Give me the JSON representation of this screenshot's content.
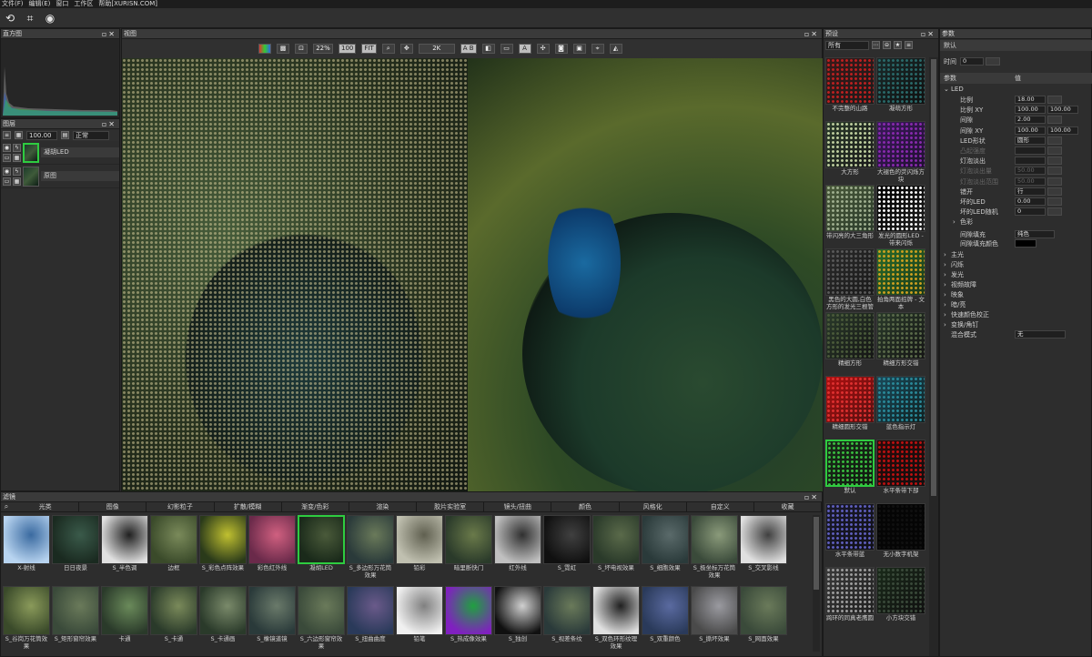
{
  "menu": [
    "文件(F)",
    "编辑(E)",
    "窗口",
    "工作区",
    "帮助[XURISN.COM]"
  ],
  "toolbar_icons": [
    "refresh-icon",
    "crop-icon",
    "compare-icon"
  ],
  "histogram": {
    "title": "直方图"
  },
  "layers": {
    "title": "图层",
    "opacity": "100.00",
    "blend_mode": "正常",
    "items": [
      {
        "name": "凝胡LED"
      },
      {
        "name": "原图"
      }
    ]
  },
  "view": {
    "title": "视图",
    "zoom": "22%",
    "btn_100": "100",
    "btn_fit": "FIT",
    "res_select": "2K",
    "ab_label": "A B",
    "ab2_label": "A"
  },
  "presets": {
    "title": "预设",
    "filter": "所有",
    "items": [
      {
        "label": "不完整的山路",
        "colors": [
          "#3a1a1a",
          "#c02020",
          "#1a1a1a"
        ]
      },
      {
        "label": "凝萌方形",
        "colors": [
          "#1a2a2a",
          "#2a6a6a",
          "#101010"
        ]
      },
      {
        "label": "大方形",
        "colors": [
          "#2a3a2a",
          "#c0d0a0",
          "#1a1a1a"
        ]
      },
      {
        "label": "大褪色的荧闪烁方块",
        "colors": [
          "#3a1a5a",
          "#8a2ab0",
          "#201030"
        ]
      },
      {
        "label": "带闪亮的大三角形",
        "colors": [
          "#4a5a3a",
          "#a0b090",
          "#2a3a2a"
        ]
      },
      {
        "label": "发光的圆形LED - 带来闪烁",
        "colors": [
          "#000000",
          "#ffffff",
          "#202020"
        ]
      },
      {
        "label": "黑色的大圆,白色方形的发光三根管",
        "colors": [
          "#2a2a2a",
          "#5a5a5a",
          "#1a1a1a"
        ]
      },
      {
        "label": "拍角两面招牌 - 文本",
        "colors": [
          "#2a6a2a",
          "#d0a020",
          "#1a3a1a"
        ]
      },
      {
        "label": "精细方形",
        "colors": [
          "#2a3a2a",
          "#4a5a3a",
          "#151515"
        ]
      },
      {
        "label": "精细方形交错",
        "colors": [
          "#2a3a2a",
          "#5a6a4a",
          "#151515"
        ]
      },
      {
        "label": "精细圆形交错",
        "colors": [
          "#b01010",
          "#e03030",
          "#501010"
        ]
      },
      {
        "label": "蓝色指示灯",
        "colors": [
          "#1a4a5a",
          "#2a8a9a",
          "#102020"
        ]
      },
      {
        "label": "默认",
        "colors": [
          "#1a2a1a",
          "#3ac040",
          "#101a10"
        ]
      },
      {
        "label": "水平条带下部",
        "colors": [
          "#2a0a0a",
          "#c01010",
          "#101010"
        ]
      },
      {
        "label": "水平条带蓝",
        "colors": [
          "#1a1a2a",
          "#6060c0",
          "#101018"
        ]
      },
      {
        "label": "无小数字机架",
        "colors": [
          "#050505",
          "#101010",
          "#050505"
        ]
      },
      {
        "label": "跨环的同真老鹰圆",
        "colors": [
          "#3a3a3a",
          "#a0a0a0",
          "#202020"
        ]
      },
      {
        "label": "小方块交错",
        "colors": [
          "#1a2a1a",
          "#3a4a3a",
          "#101010"
        ]
      }
    ]
  },
  "params": {
    "title": "参数",
    "preset_label": "默认",
    "time_label": "时间",
    "time_value": "0",
    "col_param": "参数",
    "col_value": "值",
    "group_led": "LED",
    "rows": [
      {
        "label": "比例",
        "v1": "18.00",
        "v2": "",
        "dim": false
      },
      {
        "label": "比例 XY",
        "v1": "100.00",
        "v2": "100.00",
        "dim": false
      },
      {
        "label": "间隙",
        "v1": "2.00",
        "v2": "",
        "dim": false
      },
      {
        "label": "间隙 XY",
        "v1": "100.00",
        "v2": "100.00",
        "dim": false
      },
      {
        "label": "LED形状",
        "v1": "圆形",
        "v2": "",
        "dim": false
      },
      {
        "label": "凸起强度",
        "v1": "",
        "v2": "",
        "dim": true
      },
      {
        "label": "灯泡淡出",
        "v1": "",
        "v2": "",
        "dim": false
      },
      {
        "label": "灯泡淡出量",
        "v1": "50.00",
        "v2": "",
        "dim": true
      },
      {
        "label": "灯泡淡出范围",
        "v1": "50.00",
        "v2": "",
        "dim": true
      },
      {
        "label": "错开",
        "v1": "行",
        "v2": "",
        "dim": false
      },
      {
        "label": "坏的LED",
        "v1": "0.00",
        "v2": "",
        "dim": false
      },
      {
        "label": "坏的LED随机",
        "v1": "0",
        "v2": "",
        "dim": false
      }
    ],
    "sub_color": "色彩",
    "gap_fill_label": "间隙填充",
    "gap_fill_value": "纯色",
    "gap_color_label": "间隙填充颜色",
    "groups": [
      "主光",
      "闪烁",
      "发光",
      "视频故障",
      "映象",
      "暗/亮",
      "快速颜色校正",
      "变换/角钉"
    ],
    "blend_label": "混合模式",
    "blend_value": "无"
  },
  "filters": {
    "title": "滤镜",
    "categories": [
      "光类",
      "图像",
      "幻影粒子",
      "扩散/模糊",
      "渐变/色彩",
      "渲染",
      "胶片实验室",
      "镜头/扭曲",
      "颜色",
      "风格化",
      "自定义",
      "收藏"
    ],
    "items": [
      {
        "label": "X-射线",
        "colors": [
          "#b8d4f0",
          "#3a6aa0"
        ]
      },
      {
        "label": "日日夜景",
        "colors": [
          "#1a2a20",
          "#3a5a4a"
        ]
      },
      {
        "label": "S_半色调",
        "colors": [
          "#e0e0e0",
          "#202020"
        ]
      },
      {
        "label": "边框",
        "colors": [
          "#3a4a2a",
          "#7a8a5a"
        ]
      },
      {
        "label": "S_彩色点阵效果",
        "colors": [
          "#2a3a1a",
          "#c0c030"
        ]
      },
      {
        "label": "彩色红外线",
        "colors": [
          "#6a2a4a",
          "#d06080"
        ]
      },
      {
        "label": "凝胡LED",
        "colors": [
          "#1a2a1a",
          "#4a5a3a"
        ],
        "sel": true
      },
      {
        "label": "S_多边形万花筒效果",
        "colors": [
          "#2a3a3a",
          "#6a7a5a"
        ]
      },
      {
        "label": "铅彩",
        "colors": [
          "#c0c0b0",
          "#606050"
        ]
      },
      {
        "label": "暗里断快门",
        "colors": [
          "#2a3a2a",
          "#6a7a4a"
        ]
      },
      {
        "label": "红外线",
        "colors": [
          "#c0c0c0",
          "#303030"
        ]
      },
      {
        "label": "S_霓虹",
        "colors": [
          "#101010",
          "#404040"
        ]
      },
      {
        "label": "S_坏电视效果",
        "colors": [
          "#2a3a2a",
          "#5a6a4a"
        ]
      },
      {
        "label": "S_细胞效果",
        "colors": [
          "#2a3a3a",
          "#5a6a6a"
        ]
      },
      {
        "label": "S_极坐标万花筒效果",
        "colors": [
          "#3a4a3a",
          "#8a9a7a"
        ]
      },
      {
        "label": "S_交叉影线",
        "colors": [
          "#e0e0e0",
          "#404040"
        ]
      },
      {
        "label": "S_谷岗万花筒效果",
        "colors": [
          "#3a4a2a",
          "#8a9a5a"
        ]
      },
      {
        "label": "S_矩形窗帘效果",
        "colors": [
          "#3a4a3a",
          "#6a7a5a"
        ]
      },
      {
        "label": "卡通",
        "colors": [
          "#2a3a2a",
          "#6a8a5a"
        ]
      },
      {
        "label": "S_卡通",
        "colors": [
          "#2a3a2a",
          "#7a8a5a"
        ]
      },
      {
        "label": "S_卡通画",
        "colors": [
          "#2a3a2a",
          "#7a8a6a"
        ]
      },
      {
        "label": "S_橡镜道镜",
        "colors": [
          "#2a3a3a",
          "#6a7a6a"
        ]
      },
      {
        "label": "S_六边形窗帘效果",
        "colors": [
          "#3a4a3a",
          "#6a7a5a"
        ]
      },
      {
        "label": "S_扭曲曲度",
        "colors": [
          "#2a3a5a",
          "#6a5a8a"
        ]
      },
      {
        "label": "铅笔",
        "colors": [
          "#f0f0f0",
          "#808080"
        ]
      },
      {
        "label": "S_热成像效果",
        "colors": [
          "#8020c0",
          "#20a040"
        ]
      },
      {
        "label": "S_独创",
        "colors": [
          "#101010",
          "#d0d0d0"
        ]
      },
      {
        "label": "S_视差条纹",
        "colors": [
          "#2a3a3a",
          "#6a7a5a"
        ]
      },
      {
        "label": "S_双色环形纹理效果",
        "colors": [
          "#e0e0e0",
          "#202020"
        ]
      },
      {
        "label": "S_双重颜色",
        "colors": [
          "#2a3a5a",
          "#5a6aa0"
        ]
      },
      {
        "label": "S_撕坏效果",
        "colors": [
          "#4a4a4a",
          "#9a9aa0"
        ]
      },
      {
        "label": "S_网面效果",
        "colors": [
          "#3a4a3a",
          "#6a7a5a"
        ]
      }
    ]
  }
}
